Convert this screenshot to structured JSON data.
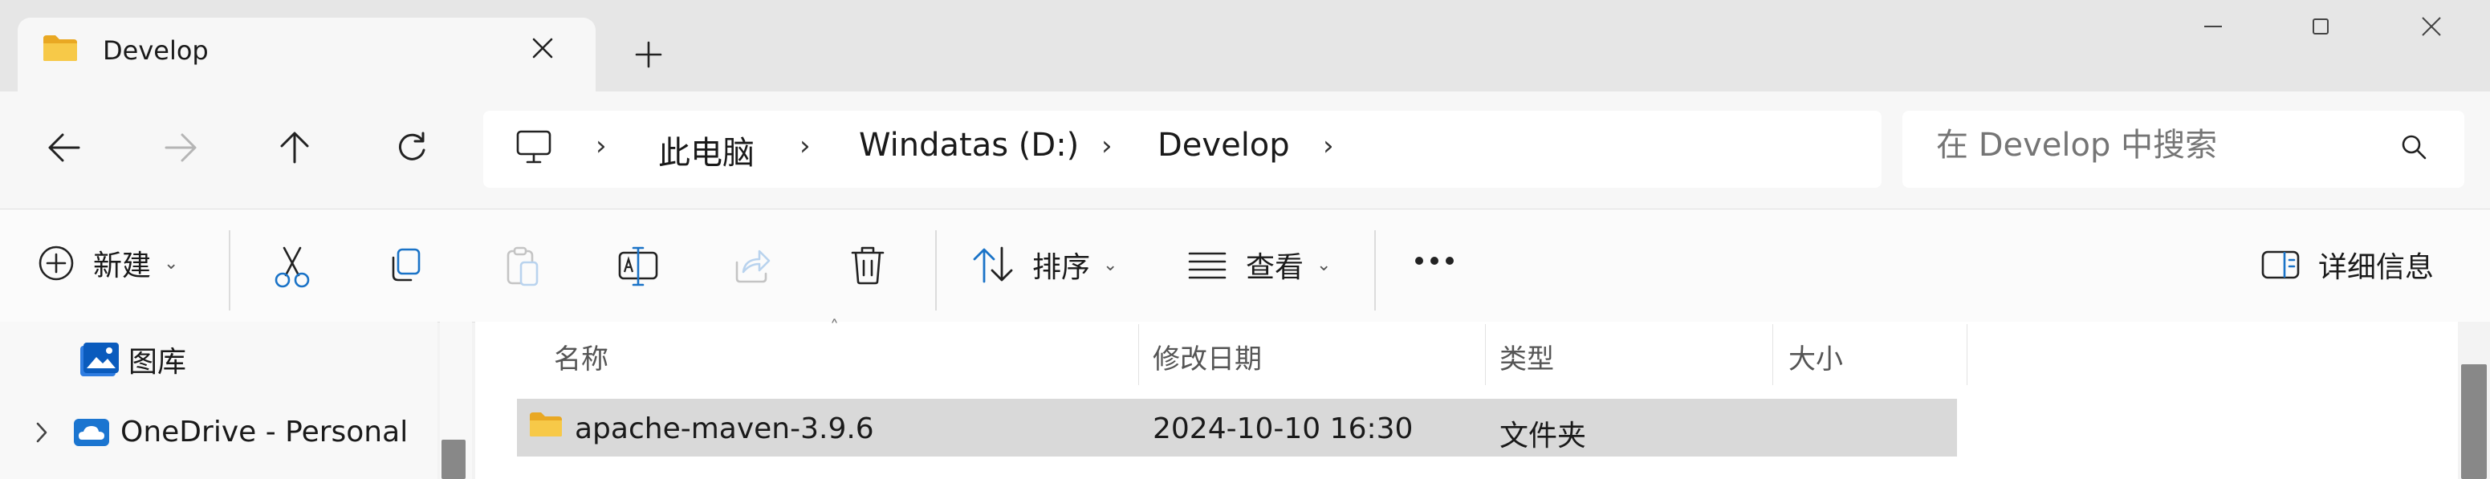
{
  "window": {
    "tab_title": "Develop",
    "new_tab_symbol": "+",
    "controls": [
      "minimize-icon",
      "maximize-icon",
      "close-icon"
    ]
  },
  "navigation": {
    "buttons": [
      "back-arrow-icon",
      "forward-arrow-icon",
      "up-arrow-icon",
      "refresh-icon"
    ],
    "breadcrumb_root_icon": "computer-icon",
    "breadcrumb": [
      "此电脑",
      "Windatas (D:)",
      "Develop"
    ],
    "separator": "›"
  },
  "search": {
    "placeholder": "在 Develop 中搜索"
  },
  "commandbar": {
    "new_label": "新建",
    "sort_label": "排序",
    "view_label": "查看",
    "details_label": "详细信息",
    "icons": [
      "new-icon",
      "cut-icon",
      "copy-icon",
      "paste-icon",
      "rename-icon",
      "share-icon",
      "delete-icon",
      "sort-icon",
      "view-icon",
      "more-icon",
      "details-pane-icon"
    ],
    "dropdown_symbol": "⌄",
    "more_symbol": "•••"
  },
  "navpane": {
    "items": [
      {
        "label": "图库",
        "icon": "gallery-icon"
      },
      {
        "label": "OneDrive - Personal",
        "icon": "onedrive-cloud-icon",
        "expander": "›"
      }
    ]
  },
  "filelist": {
    "columns": {
      "name": "名称",
      "date": "修改日期",
      "type": "类型",
      "size": "大小"
    },
    "sort_indicator": "˄",
    "sort_column": "名称",
    "rows": [
      {
        "name": "apache-maven-3.9.6",
        "date": "2024-10-10 16:30",
        "type": "文件夹",
        "size": "",
        "selected": true,
        "icon": "folder-icon"
      }
    ]
  },
  "colors": {
    "titlebar": "#e6e6e6",
    "tab": "#f7f7f7",
    "selected_row": "#d9d9d9",
    "folder": "#f5c342",
    "accent": "#0078d4"
  }
}
